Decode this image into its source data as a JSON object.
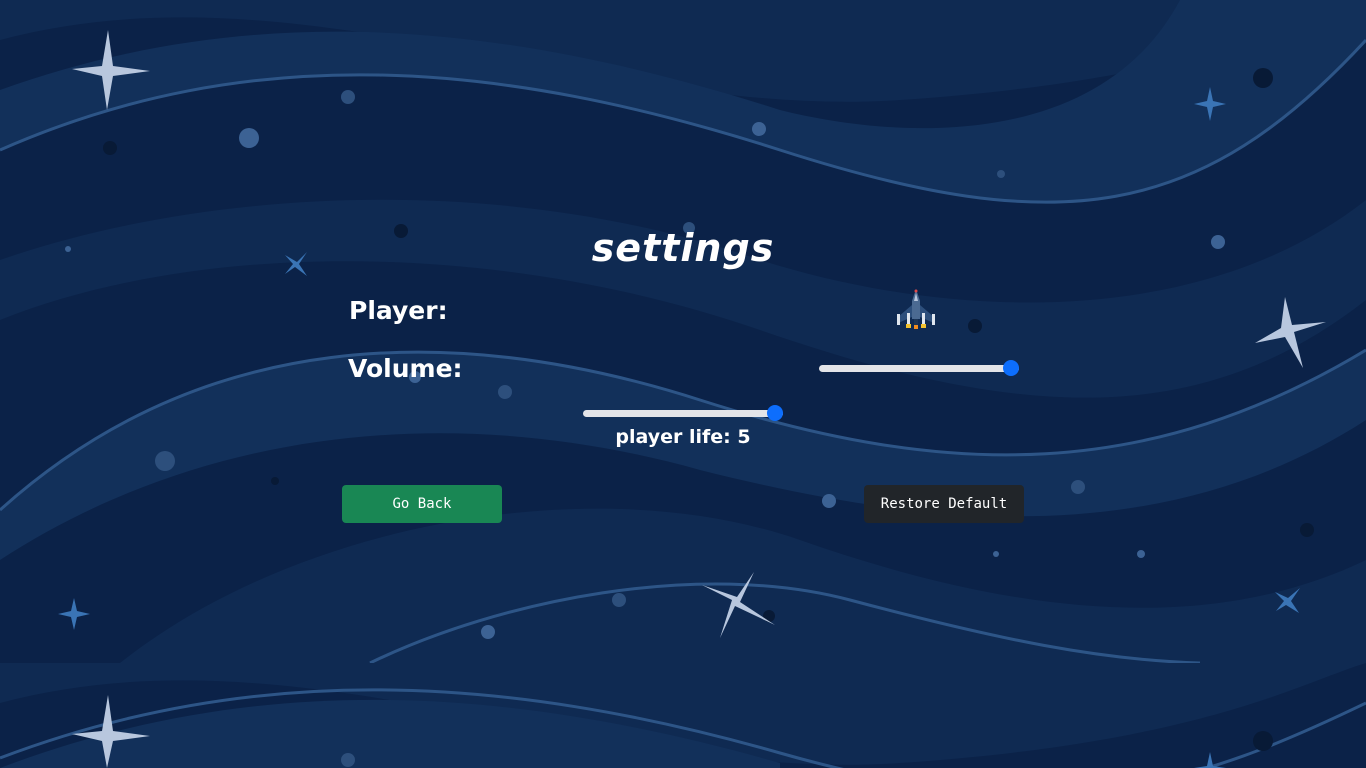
{
  "settings": {
    "title": "settings",
    "player_label": "Player:",
    "volume_label": "Volume:",
    "volume_value": 1.0,
    "player_life_value": 1.0,
    "player_life_text": "player life: 5",
    "player_ship_icon": "spaceship-icon"
  },
  "buttons": {
    "go_back": "Go Back",
    "restore_default": "Restore Default"
  },
  "colors": {
    "background": "#0b2248",
    "go_back_button": "#198754",
    "restore_button": "#212529",
    "slider_thumb": "#0d6efd",
    "slider_track": "#e3e4e8"
  }
}
